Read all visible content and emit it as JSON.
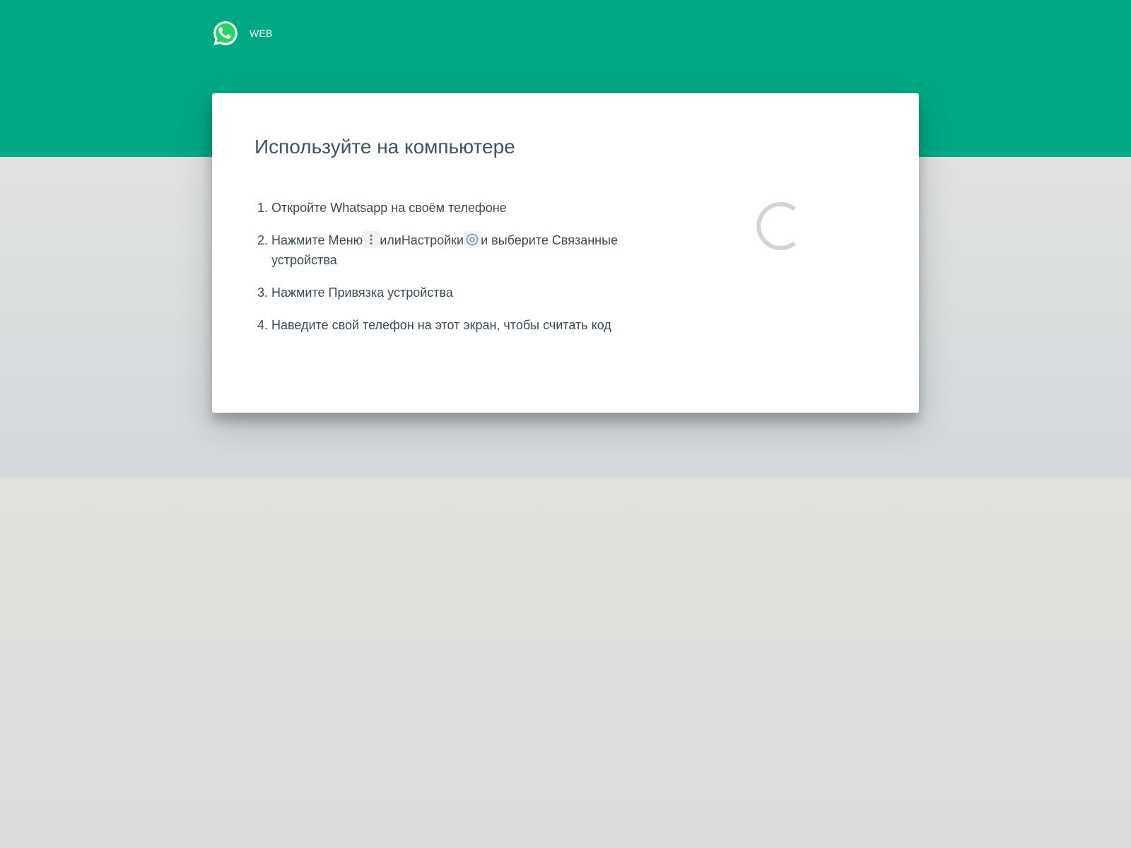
{
  "header": {
    "logo_icon": "whatsapp-logo-icon",
    "brand_label": "WEB"
  },
  "colors": {
    "brand_green": "#00a884",
    "text_primary": "#41525d",
    "spinner": "#d1d3d4"
  },
  "card": {
    "title": "Используйте на компьютере",
    "steps": [
      {
        "number": "1.",
        "text": "Откройте Whatsapp на своём телефоне"
      },
      {
        "number": "2.",
        "prefix": "Нажмите Меню",
        "menu_icon": "vertical-dots-icon",
        "middle": "или",
        "settings_label": "Настройки",
        "settings_icon": "settings-gear-icon",
        "suffix": "и выберите Связанные устройства"
      },
      {
        "number": "3.",
        "text": "Нажмите Привязка устройства"
      },
      {
        "number": "4.",
        "text": "Наведите свой телефон на этот экран, чтобы считать код"
      }
    ],
    "qr_status_icon": "loading-spinner-icon"
  }
}
